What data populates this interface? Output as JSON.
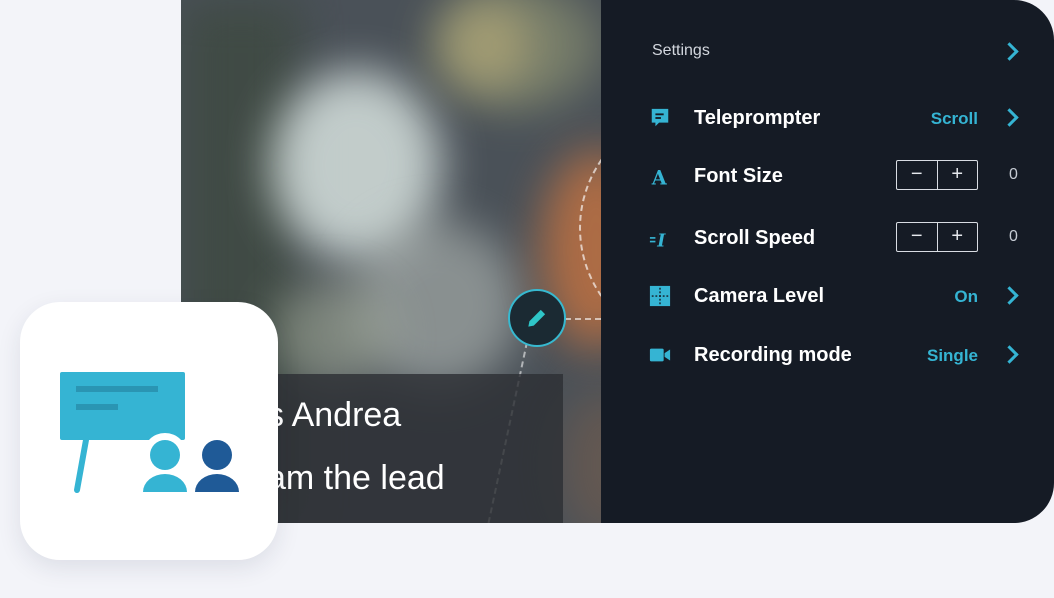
{
  "teleprompter_script": {
    "line1": "s Andrea",
    "line2": "am the lead"
  },
  "settings": {
    "title": "Settings",
    "rows": [
      {
        "label": "Teleprompter",
        "value": "Scroll",
        "icon": "teleprompter-icon"
      },
      {
        "label": "Font Size",
        "value": "0",
        "icon": "font-size-icon",
        "minus": "−",
        "plus": "+"
      },
      {
        "label": "Scroll Speed",
        "value": "0",
        "icon": "scroll-speed-icon",
        "minus": "−",
        "plus": "+"
      },
      {
        "label": "Camera Level",
        "value": "On",
        "icon": "camera-level-icon"
      },
      {
        "label": "Recording mode",
        "value": "Single",
        "icon": "video-camera-icon"
      }
    ]
  },
  "colors": {
    "accent": "#35b4d3",
    "panel_bg": "#151b25",
    "page_bg": "#f3f4f9"
  }
}
